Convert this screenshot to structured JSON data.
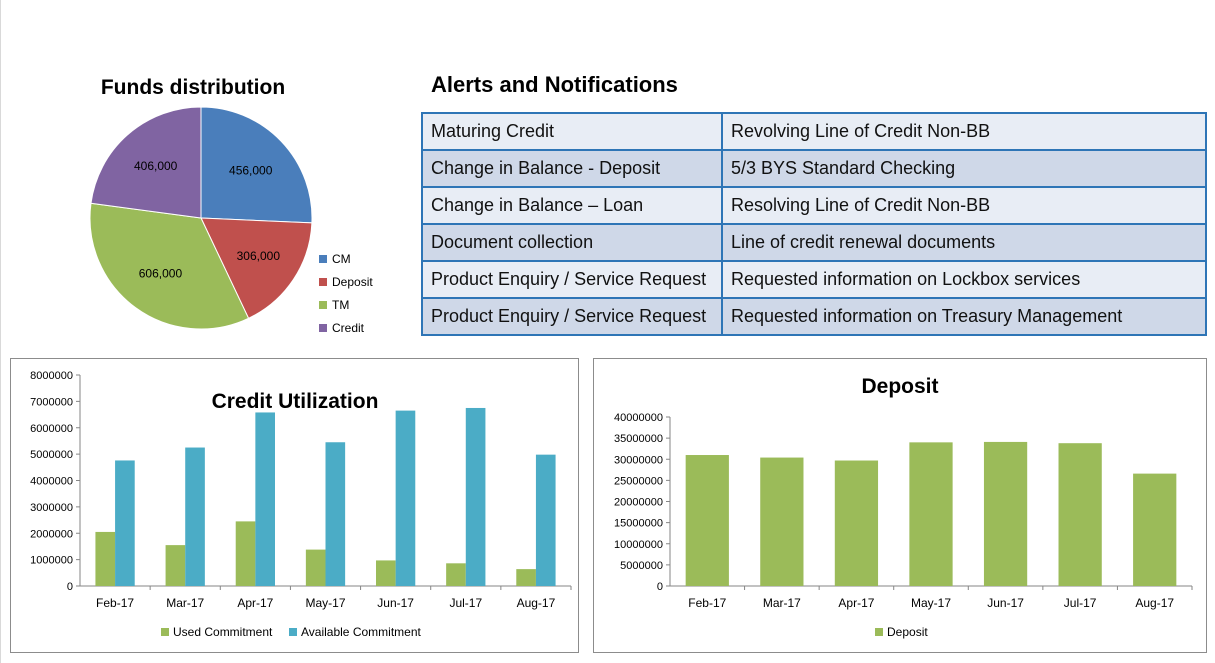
{
  "colors": {
    "cm": "#4a7ebb",
    "deposit_slice": "#c0504d",
    "tm": "#9bbb59",
    "credit_slice": "#8064a2",
    "used_commitment": "#9bbb59",
    "available_commitment": "#4bacc6",
    "deposit_bar": "#9bbb59",
    "table_border": "#2e75b6"
  },
  "alerts": {
    "title": "Alerts and Notifications",
    "rows": [
      {
        "type": "Maturing Credit",
        "detail": "Revolving Line of Credit Non-BB"
      },
      {
        "type": "Change in Balance - Deposit",
        "detail": "5/3 BYS Standard Checking"
      },
      {
        "type": "Change in Balance – Loan",
        "detail": "Resolving Line of Credit Non-BB"
      },
      {
        "type": "Document collection",
        "detail": "Line of credit renewal documents"
      },
      {
        "type": "Product Enquiry / Service Request",
        "detail": "Requested information on Lockbox services"
      },
      {
        "type": "Product Enquiry / Service Request",
        "detail": "Requested information on Treasury Management"
      }
    ]
  },
  "chart_data": [
    {
      "type": "pie",
      "title": "Funds distribution",
      "labels": [
        "CM",
        "Deposit",
        "TM",
        "Credit"
      ],
      "values": [
        456000,
        306000,
        606000,
        406000
      ],
      "data_labels": [
        "456,000",
        "306,000",
        "606,000",
        "406,000"
      ],
      "legend": "right"
    },
    {
      "type": "bar",
      "title": "Credit Utilization",
      "categories": [
        "Feb-17",
        "Mar-17",
        "Apr-17",
        "May-17",
        "Jun-17",
        "Jul-17",
        "Aug-17"
      ],
      "series": [
        {
          "name": "Used Commitment",
          "values": [
            2050000,
            1550000,
            2450000,
            1380000,
            970000,
            860000,
            640000
          ]
        },
        {
          "name": "Available Commitment",
          "values": [
            4760000,
            5250000,
            6580000,
            5450000,
            6650000,
            6750000,
            4980000
          ]
        }
      ],
      "ylim": [
        0,
        8000000
      ],
      "yticks": [
        "0",
        "1000000",
        "2000000",
        "3000000",
        "4000000",
        "5000000",
        "6000000",
        "7000000",
        "8000000"
      ],
      "legend": "bottom",
      "grid": false
    },
    {
      "type": "bar",
      "title": "Deposit",
      "categories": [
        "Feb-17",
        "Mar-17",
        "Apr-17",
        "May-17",
        "Jun-17",
        "Jul-17",
        "Aug-17"
      ],
      "series": [
        {
          "name": "Deposit",
          "values": [
            31000000,
            30400000,
            29700000,
            34000000,
            34100000,
            33800000,
            26600000
          ]
        }
      ],
      "ylim": [
        0,
        40000000
      ],
      "yticks": [
        "0",
        "5000000",
        "10000000",
        "15000000",
        "20000000",
        "25000000",
        "30000000",
        "35000000",
        "40000000"
      ],
      "legend": "bottom",
      "grid": false
    }
  ]
}
